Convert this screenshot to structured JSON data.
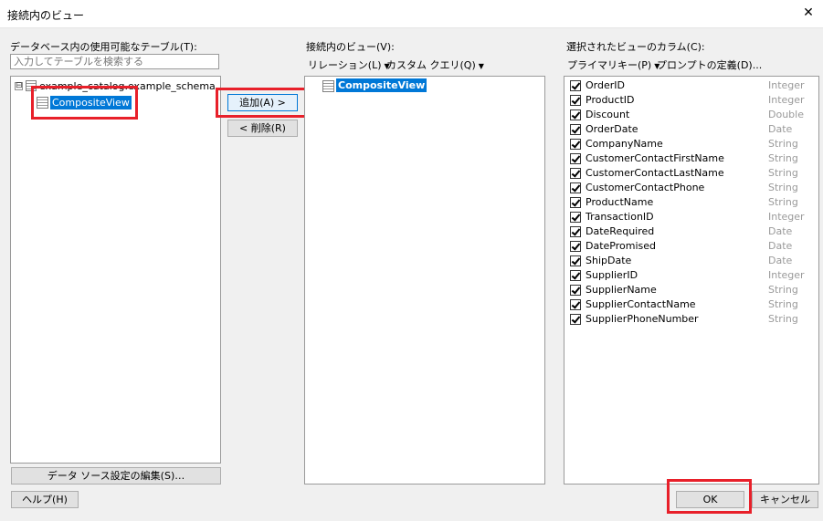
{
  "window": {
    "title": "接続内のビュー",
    "close_glyph": "✕"
  },
  "left": {
    "label": "データベース内の使用可能なテーブル(T):",
    "search_placeholder": "入力してテーブルを検索する",
    "tree": {
      "expander": "⊟",
      "root": "example_catalog.example_schema",
      "child": "CompositeView"
    },
    "edit_button": "データ ソース設定の編集(S)…",
    "help_button": "ヘルプ(H)"
  },
  "middle": {
    "add_button": "追加(A) >",
    "remove_button": "< 削除(R)"
  },
  "views": {
    "label": "接続内のビュー(V):",
    "relation_menu": "リレーション(L)",
    "custom_query_menu": "カスタム クエリ(Q)",
    "items": [
      "CompositeView"
    ]
  },
  "columns": {
    "label": "選択されたビューのカラム(C):",
    "primary_key_menu": "プライマリキー(P)",
    "prompt_def": "プロンプトの定義(D)...",
    "items": [
      {
        "name": "OrderID",
        "type": "Integer"
      },
      {
        "name": "ProductID",
        "type": "Integer"
      },
      {
        "name": "Discount",
        "type": "Double"
      },
      {
        "name": "OrderDate",
        "type": "Date"
      },
      {
        "name": "CompanyName",
        "type": "String"
      },
      {
        "name": "CustomerContactFirstName",
        "type": "String"
      },
      {
        "name": "CustomerContactLastName",
        "type": "String"
      },
      {
        "name": "CustomerContactPhone",
        "type": "String"
      },
      {
        "name": "ProductName",
        "type": "String"
      },
      {
        "name": "TransactionID",
        "type": "Integer"
      },
      {
        "name": "DateRequired",
        "type": "Date"
      },
      {
        "name": "DatePromised",
        "type": "Date"
      },
      {
        "name": "ShipDate",
        "type": "Date"
      },
      {
        "name": "SupplierID",
        "type": "Integer"
      },
      {
        "name": "SupplierName",
        "type": "String"
      },
      {
        "name": "SupplierContactName",
        "type": "String"
      },
      {
        "name": "SupplierPhoneNumber",
        "type": "String"
      }
    ]
  },
  "footer": {
    "ok_button": "OK",
    "cancel_button": "キャンセル"
  },
  "colors": {
    "highlight": "#0078d7",
    "annotation_red": "#e8202a"
  }
}
